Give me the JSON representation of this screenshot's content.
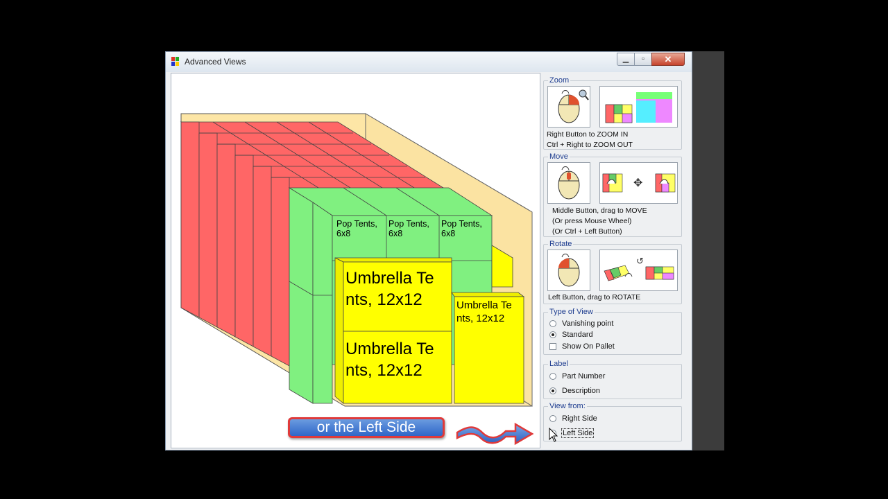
{
  "window": {
    "title": "Advanced Views",
    "close_glyph": "✕"
  },
  "canvas": {
    "banner": "or the Left Side",
    "labels": {
      "pop_tent": "Pop Tents,\n6x8",
      "umbrella_tent": "Umbrella Te\nnts, 12x12"
    }
  },
  "zoom": {
    "title": "Zoom",
    "line1": "Right Button to ZOOM IN",
    "line2": "Ctrl + Right to ZOOM OUT"
  },
  "move": {
    "title": "Move",
    "line1": "Middle Button, drag to MOVE",
    "line2": "(Or press Mouse Wheel)",
    "line3": "(Or Ctrl + Left Button)"
  },
  "rotate": {
    "title": "Rotate",
    "line1": "Left Button, drag to ROTATE"
  },
  "type_of_view": {
    "title": "Type of View",
    "vanishing_point": "Vanishing point",
    "standard": "Standard",
    "show_on_pallet": "Show On Pallet",
    "selected": "Standard",
    "show_on_pallet_checked": false
  },
  "label": {
    "title": "Label",
    "part_number": "Part Number",
    "description": "Description",
    "selected": "Description"
  },
  "view_from": {
    "title": "View from:",
    "right_side": "Right Side",
    "left_side": "Left Side",
    "selected": "Left Side"
  },
  "colors": {
    "red_box": "#ff6666",
    "green_box": "#80f080",
    "yellow_box": "#ffff00",
    "container": "#fde6a6"
  }
}
